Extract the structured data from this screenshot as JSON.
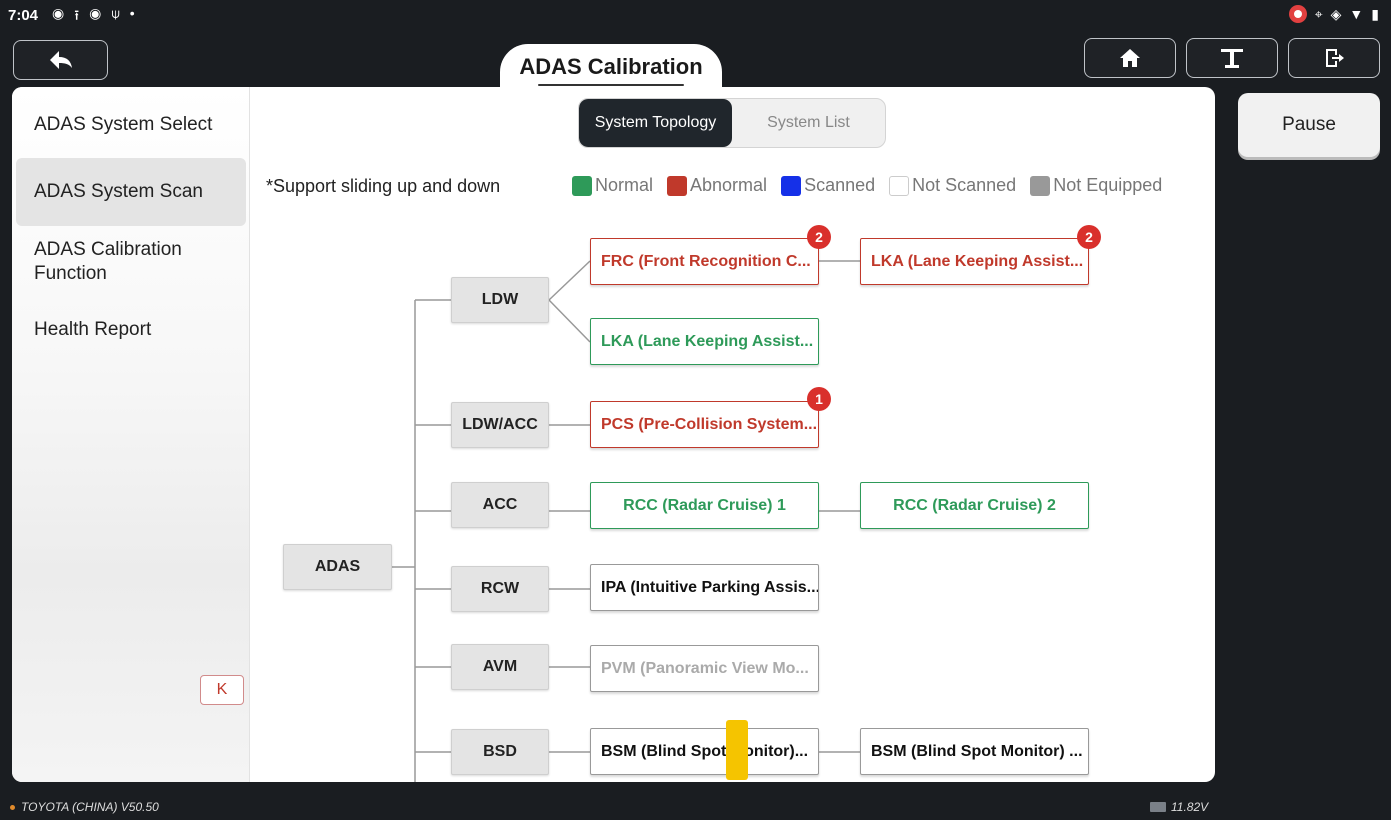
{
  "status_bar": {
    "time": "7:04",
    "left_icons": [
      "record-icon",
      "upload-icon",
      "record-icon",
      "usb-icon",
      "dot-icon"
    ],
    "right_icons": [
      "screen-record-icon",
      "location-icon",
      "vibrate-icon",
      "wifi-icon",
      "battery-icon"
    ]
  },
  "header": {
    "title": "ADAS Calibration",
    "back_icon": "back-arrow-icon",
    "home_icon": "home-icon",
    "tool_icon": "lift-tool-icon",
    "exit_icon": "exit-icon"
  },
  "sidebar": {
    "items": [
      {
        "label": "ADAS System Select",
        "active": false
      },
      {
        "label": "ADAS System Scan",
        "active": true
      },
      {
        "label": "ADAS Calibration Function",
        "active": false
      },
      {
        "label": "Health Report",
        "active": false
      }
    ],
    "collapse_label": "K"
  },
  "view_toggle": {
    "options": [
      "System Topology",
      "System List"
    ],
    "selected": "System Topology"
  },
  "hint": "*Support sliding up and down",
  "legend": [
    {
      "label": "Normal",
      "color": "#2e9a59"
    },
    {
      "label": "Abnormal",
      "color": "#c0392b"
    },
    {
      "label": "Scanned",
      "color": "#1530e8"
    },
    {
      "label": "Not Scanned",
      "color": "#ffffff"
    },
    {
      "label": "Not Equipped",
      "color": "#999999"
    }
  ],
  "topology": {
    "root": "ADAS",
    "categories": [
      "LDW",
      "LDW/ACC",
      "ACC",
      "RCW",
      "AVM",
      "BSD"
    ],
    "ecus": [
      {
        "label": "FRC (Front Recognition C...",
        "status": "abnormal",
        "badge": "2"
      },
      {
        "label": "LKA (Lane Keeping Assist...",
        "status": "abnormal",
        "badge": "2"
      },
      {
        "label": "LKA (Lane Keeping Assist...",
        "status": "normal",
        "badge": null
      },
      {
        "label": "PCS (Pre-Collision System...",
        "status": "abnormal",
        "badge": "1"
      },
      {
        "label": "RCC (Radar Cruise) 1",
        "status": "normal",
        "badge": null
      },
      {
        "label": "RCC (Radar Cruise) 2",
        "status": "normal",
        "badge": null
      },
      {
        "label": "IPA (Intuitive Parking Assis...",
        "status": "not-scanned",
        "badge": null
      },
      {
        "label": "PVM (Panoramic View Mo...",
        "status": "not-equipped",
        "badge": null
      },
      {
        "label": "BSM (Blind Spot Monitor)...",
        "status": "not-scanned",
        "badge": null
      },
      {
        "label": "BSM (Blind Spot Monitor) ...",
        "status": "not-scanned",
        "badge": null
      }
    ]
  },
  "actions": {
    "pause_label": "Pause"
  },
  "footer": {
    "version": "TOYOTA (CHINA) V50.50",
    "voltage": "11.82V"
  }
}
